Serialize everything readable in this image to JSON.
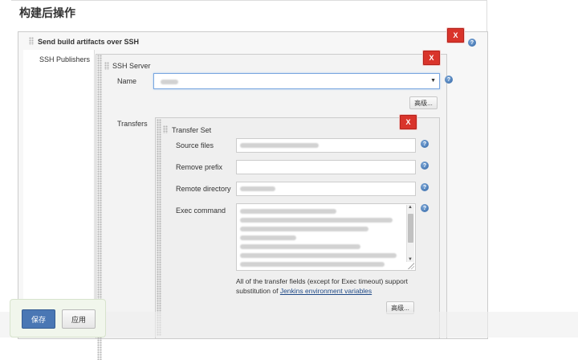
{
  "section": {
    "title": "构建后操作"
  },
  "step": {
    "title": "Send build artifacts over SSH",
    "delete_label": "X"
  },
  "publishers": {
    "label": "SSH Publishers"
  },
  "server": {
    "title": "SSH Server",
    "delete_label": "X",
    "name_label": "Name",
    "name_value": "",
    "advanced_label": "高级..."
  },
  "transfers": {
    "label": "Transfers",
    "set_title": "Transfer Set",
    "delete_label": "X",
    "fields": {
      "source_files": {
        "label": "Source files",
        "value": ""
      },
      "remove_prefix": {
        "label": "Remove prefix",
        "value": ""
      },
      "remote_directory": {
        "label": "Remote directory",
        "value": ""
      },
      "exec_command": {
        "label": "Exec command",
        "value": ""
      }
    },
    "note_text": "All of the transfer fields (except for Exec timeout) support substitution of",
    "note_link": "Jenkins environment variables",
    "advanced_label": "高级..."
  },
  "help_icon_glyph": "?",
  "footer": {
    "save_label": "保存",
    "apply_label": "应用"
  },
  "colors": {
    "delete_button": "#d9342b",
    "save_button": "#4a77b4",
    "help_icon": "#2f64a5",
    "link": "#204a87"
  }
}
